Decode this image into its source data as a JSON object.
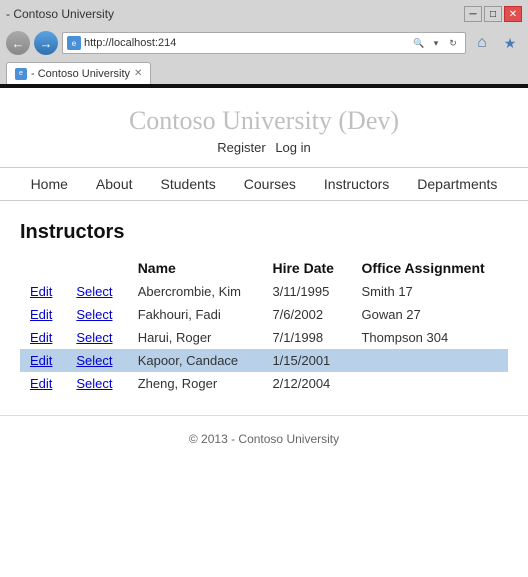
{
  "browser": {
    "title": "- Contoso University",
    "address": "http://localhost:214",
    "tab_label": "- Contoso University"
  },
  "header": {
    "site_title": "Contoso University (Dev)",
    "register_link": "Register",
    "login_link": "Log in"
  },
  "nav": {
    "items": [
      {
        "label": "Home"
      },
      {
        "label": "About"
      },
      {
        "label": "Students"
      },
      {
        "label": "Courses"
      },
      {
        "label": "Instructors"
      },
      {
        "label": "Departments"
      }
    ]
  },
  "page": {
    "heading": "Instructors",
    "table": {
      "columns": [
        "",
        "",
        "Name",
        "Hire Date",
        "Office Assignment"
      ],
      "rows": [
        {
          "edit": "Edit",
          "select": "Select",
          "name": "Abercrombie, Kim",
          "hire_date": "3/11/1995",
          "office": "Smith 17",
          "highlighted": false
        },
        {
          "edit": "Edit",
          "select": "Select",
          "name": "Fakhouri, Fadi",
          "hire_date": "7/6/2002",
          "office": "Gowan 27",
          "highlighted": false
        },
        {
          "edit": "Edit",
          "select": "Select",
          "name": "Harui, Roger",
          "hire_date": "7/1/1998",
          "office": "Thompson 304",
          "highlighted": false
        },
        {
          "edit": "Edit",
          "select": "Select",
          "name": "Kapoor, Candace",
          "hire_date": "1/15/2001",
          "office": "",
          "highlighted": true
        },
        {
          "edit": "Edit",
          "select": "Select",
          "name": "Zheng, Roger",
          "hire_date": "2/12/2004",
          "office": "",
          "highlighted": false
        }
      ]
    }
  },
  "footer": {
    "text": "© 2013 - Contoso University"
  }
}
